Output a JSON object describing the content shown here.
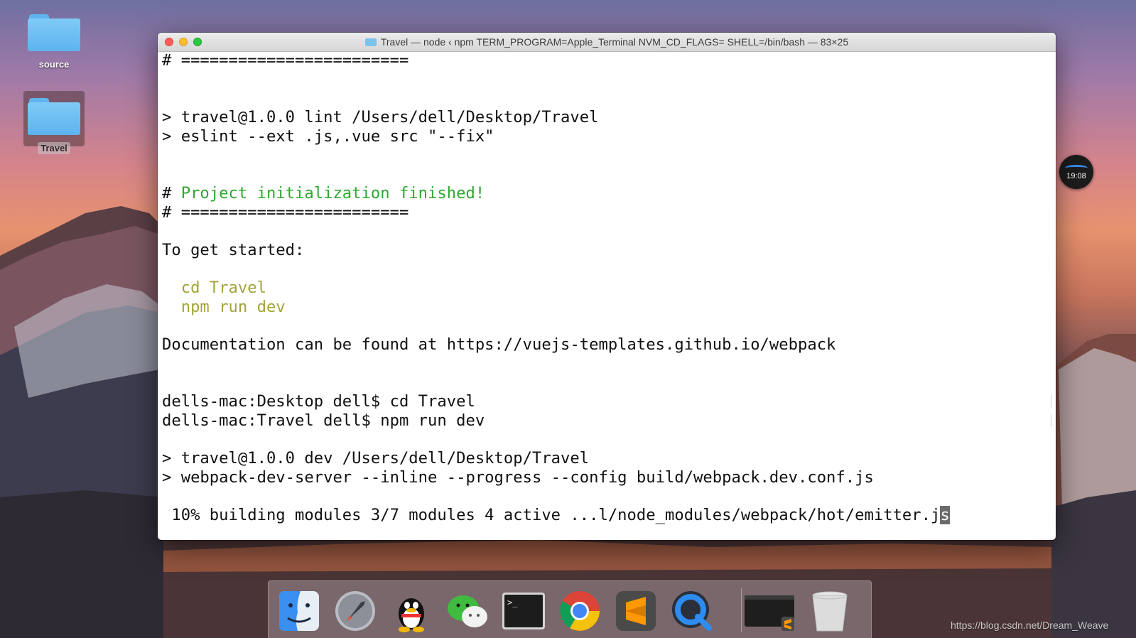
{
  "desktop": {
    "icons": [
      {
        "label": "source"
      },
      {
        "label": "Travel"
      }
    ],
    "clock": "19:08",
    "watermark": "https://blog.csdn.net/Dream_Weave"
  },
  "terminal": {
    "title": "Travel — node ‹ npm TERM_PROGRAM=Apple_Terminal NVM_CD_FLAGS= SHELL=/bin/bash — 83×25",
    "lines": {
      "l0": "# ========================",
      "l1": "> travel@1.0.0 lint /Users/dell/Desktop/Travel",
      "l2": "> eslint --ext .js,.vue src \"--fix\"",
      "l3_prefix": "# ",
      "l3_text": "Project initialization finished!",
      "l4": "# ========================",
      "l5": "To get started:",
      "l6": "  cd Travel",
      "l7": "  npm run dev",
      "l8": "Documentation can be found at https://vuejs-templates.github.io/webpack",
      "l9": "dells-mac:Desktop dell$ cd Travel",
      "l10": "dells-mac:Travel dell$ npm run dev",
      "l11": "> travel@1.0.0 dev /Users/dell/Desktop/Travel",
      "l12": "> webpack-dev-server --inline --progress --config build/webpack.dev.conf.js",
      "l13": " 10% building modules 3/7 modules 4 active ...l/node_modules/webpack/hot/emitter.j",
      "l13_cursor": "s"
    },
    "colors": {
      "success": "#2fa82f",
      "command_hint": "#a3a33a"
    }
  },
  "dock": {
    "items": [
      {
        "icon": "finder-icon"
      },
      {
        "icon": "launchpad-icon"
      },
      {
        "icon": "qq-icon"
      },
      {
        "icon": "wechat-icon"
      },
      {
        "icon": "terminal-icon"
      },
      {
        "icon": "chrome-icon"
      },
      {
        "icon": "sublime-text-icon"
      },
      {
        "icon": "quicktime-icon"
      },
      {
        "icon": "terminal-window-icon"
      },
      {
        "icon": "trash-icon"
      }
    ]
  }
}
